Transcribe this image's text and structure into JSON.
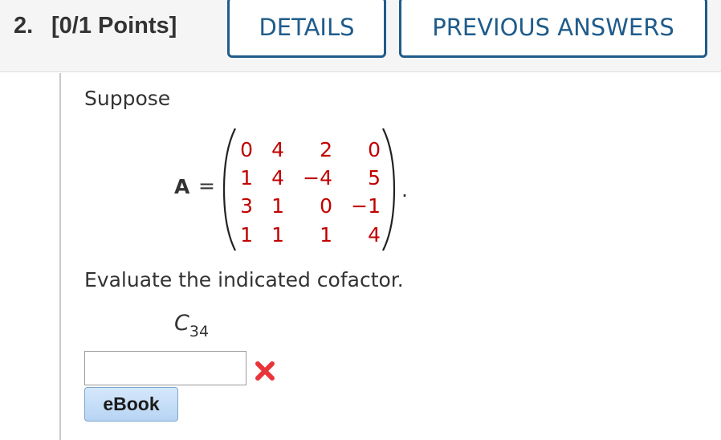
{
  "header": {
    "question_number": "2.",
    "points": "[0/1 Points]",
    "details_label": "DETAILS",
    "previous_answers_label": "PREVIOUS ANSWERS"
  },
  "question": {
    "intro": "Suppose",
    "matrix_name": "A",
    "equals": "=",
    "matrix": [
      [
        "0",
        "4",
        "2",
        "0"
      ],
      [
        "1",
        "4",
        "−4",
        "5"
      ],
      [
        "3",
        "1",
        "0",
        "−1"
      ],
      [
        "1",
        "1",
        "1",
        "4"
      ]
    ],
    "period": ".",
    "instruction": "Evaluate the indicated cofactor.",
    "cofactor_letter": "C",
    "cofactor_subscript": "34"
  },
  "answer": {
    "value": "",
    "status": "incorrect",
    "status_icon": "x-mark-icon",
    "status_color": "#e8353b"
  },
  "ebook_label": "eBook",
  "colors": {
    "accent": "#1f5c8b",
    "matrix_entries": "#c00000",
    "header_bg": "#f5f5f5"
  }
}
